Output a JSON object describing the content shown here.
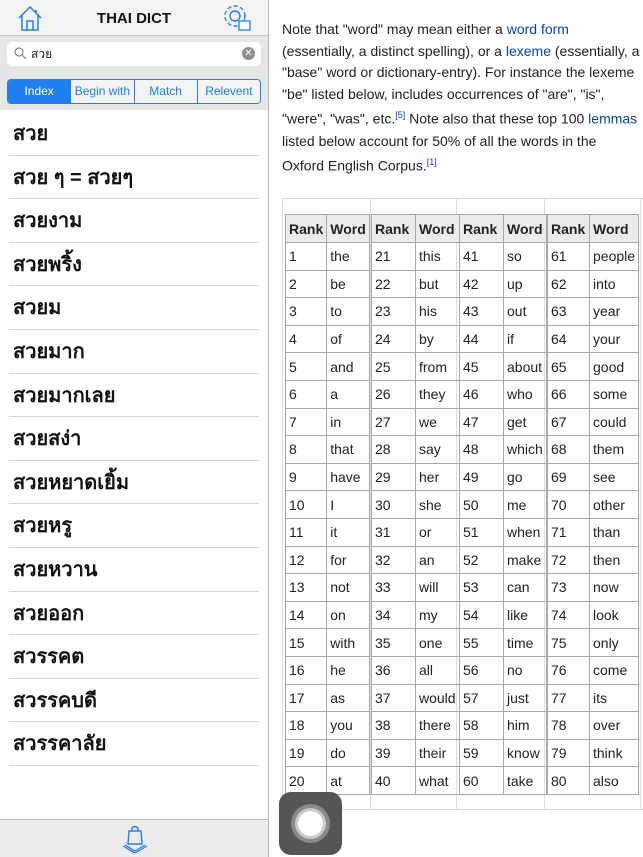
{
  "header": {
    "title": "THAI DICT",
    "home_icon": "home-icon",
    "settings_icon": "gear-icon"
  },
  "search": {
    "value": "สวย"
  },
  "segments": [
    "Index",
    "Begin with",
    "Match",
    "Relevent"
  ],
  "words": [
    "สวย",
    "สวย ๆ = สวยๆ",
    "สวยงาม",
    "สวยพริ้ง",
    "สวยม",
    "สวยมาก",
    "สวยมากเลย",
    "สวยสง่า",
    "สวยหยาดเยิ้ม",
    "สวยหรู",
    "สวยหวาน",
    "สวยออก",
    "สวรรคต",
    "สวรรคบดี",
    "สวรรคาลัย"
  ],
  "article": {
    "t1": "Note that \"word\" may mean either a ",
    "l1": "word form",
    "t2": " (essentially, a distinct spelling), or a ",
    "l2": "lexeme",
    "t3": " (essentially, a \"base\" word or dictionary-entry). For instance the lexeme \"be\" listed below, includes occurrences of \"are\", \"is\", \"were\", \"was\", etc.",
    "s1": "[5]",
    "t4": " Note also that these top 100 ",
    "l3": "lemmas",
    "t5": " listed below account for 50% of all the words in the Oxford English Corpus.",
    "s2": "[1]"
  },
  "table_headers": [
    "Rank",
    "Word"
  ],
  "tables": [
    [
      "the",
      "be",
      "to",
      "of",
      "and",
      "a",
      "in",
      "that",
      "have",
      "I",
      "it",
      "for",
      "not",
      "on",
      "with",
      "he",
      "as",
      "you",
      "do",
      "at"
    ],
    [
      "this",
      "but",
      "his",
      "by",
      "from",
      "they",
      "we",
      "say",
      "her",
      "she",
      "or",
      "an",
      "will",
      "my",
      "one",
      "all",
      "would",
      "there",
      "their",
      "what"
    ],
    [
      "so",
      "up",
      "out",
      "if",
      "about",
      "who",
      "get",
      "which",
      "go",
      "me",
      "when",
      "make",
      "can",
      "like",
      "time",
      "no",
      "just",
      "him",
      "know",
      "take"
    ],
    [
      "people",
      "into",
      "year",
      "your",
      "good",
      "some",
      "could",
      "them",
      "see",
      "other",
      "than",
      "then",
      "now",
      "look",
      "only",
      "come",
      "its",
      "over",
      "think",
      "also"
    ]
  ],
  "accent": "#1e7ff0"
}
